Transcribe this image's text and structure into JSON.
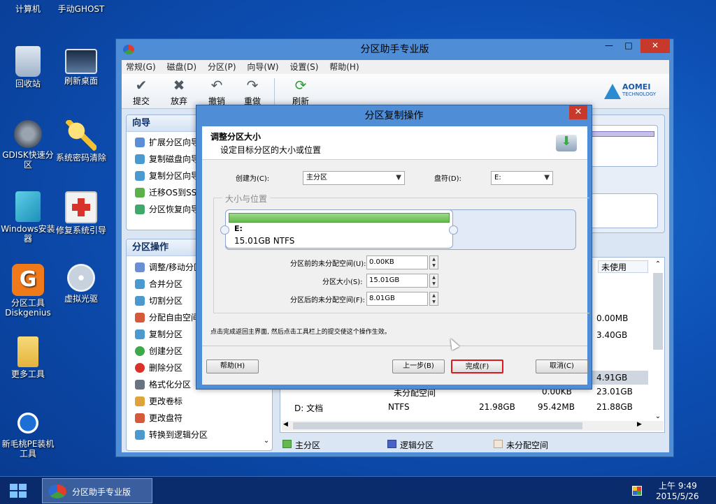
{
  "desktop": {
    "icons": [
      {
        "label": "计算机"
      },
      {
        "label": "手动GHOST"
      },
      {
        "label": "回收站"
      },
      {
        "label": "刷新桌面"
      },
      {
        "label": "GDISK快速分区"
      },
      {
        "label": "系统密码清除"
      },
      {
        "label": "Windows安装器"
      },
      {
        "label": "修复系统引导"
      },
      {
        "label": "分区工具Diskgenius"
      },
      {
        "label": "虚拟光驱"
      },
      {
        "label": "更多工具"
      },
      {
        "label": "新毛桃PE装机工具"
      }
    ]
  },
  "window": {
    "title": "分区助手专业版",
    "minimize": "—",
    "maximize": "□",
    "close": "✕",
    "menu": [
      "常规(G)",
      "磁盘(D)",
      "分区(P)",
      "向导(W)",
      "设置(S)",
      "帮助(H)"
    ],
    "toolbar": {
      "commit": "提交",
      "discard": "放弃",
      "undo": "撤销",
      "redo": "重做",
      "refresh": "刷新"
    },
    "brand": {
      "name": "AOMEI",
      "sub": "TECHNOLOGY"
    },
    "wizard_panel": {
      "title": "向导",
      "items": [
        "扩展分区向导",
        "复制磁盘向导",
        "复制分区向导",
        "迁移OS到SSD",
        "分区恢复向导"
      ]
    },
    "ops_panel": {
      "title": "分区操作",
      "items": [
        "调整/移动分区",
        "合并分区",
        "切割分区",
        "分配自由空间",
        "复制分区",
        "创建分区",
        "删除分区",
        "格式化分区",
        "更改卷标",
        "更改盘符",
        "转换到逻辑分区"
      ]
    },
    "table": {
      "header_unused": "未使用",
      "right_values": [
        "0.00MB",
        "3.40GB",
        "4.91GB",
        "23.01GB",
        "21.88GB"
      ],
      "partial_row": {
        "fs": "未分配空间",
        "used": "0.00KB"
      },
      "row_d": {
        "name": "D: 文档",
        "fs": "NTFS",
        "capacity": "21.98GB",
        "used": "95.42MB"
      }
    },
    "legend": {
      "primary": "主分区",
      "logical": "逻辑分区",
      "unallocated": "未分配空间"
    },
    "colors": {
      "primary": "#64b94e",
      "logical": "#4a62c8",
      "unallocated": "#f2e6d8"
    }
  },
  "dialog": {
    "title": "分区复制操作",
    "close": "✕",
    "heading": "调整分区大小",
    "subheading": "设定目标分区的大小或位置",
    "create_as_label": "创建为(C):",
    "create_as_value": "主分区",
    "drive_label": "盘符(D):",
    "drive_value": "E:",
    "group_title": "大小与位置",
    "partition": {
      "name": "E:",
      "size_fs": "15.01GB NTFS",
      "fill_fraction": 0.65
    },
    "before_label": "分区前的未分配空间(U):",
    "before_value": "0.00KB",
    "size_label": "分区大小(S):",
    "size_value": "15.01GB",
    "after_label": "分区后的未分配空间(F):",
    "after_value": "8.01GB",
    "hint": "点击完成返回主界面, 然后点击工具栏上的提交使这个操作生效。",
    "buttons": {
      "help": "帮助(H)",
      "back": "上一步(B)",
      "finish": "完成(F)",
      "cancel": "取消(C)"
    }
  },
  "taskbar": {
    "app_label": "分区助手专业版",
    "time": "上午 9:49",
    "date": "2015/5/26"
  }
}
